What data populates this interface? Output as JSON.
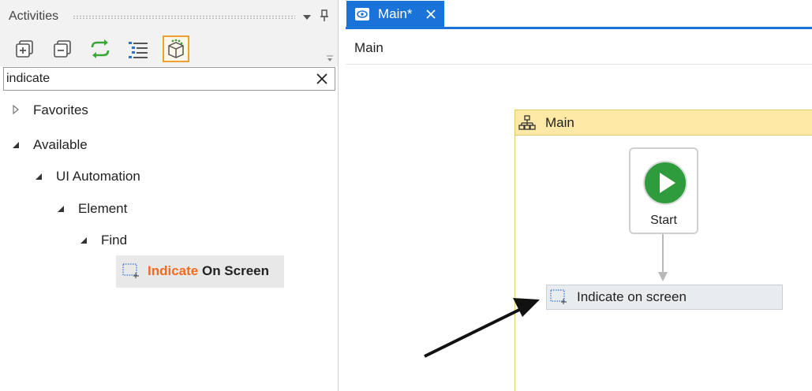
{
  "activities_panel": {
    "title": "Activities",
    "toolbar": {
      "buttons": [
        {
          "name": "expand-all",
          "icon": "expand-all-icon"
        },
        {
          "name": "collapse-all",
          "icon": "collapse-all-icon"
        },
        {
          "name": "refresh",
          "icon": "refresh-icon"
        },
        {
          "name": "view-options",
          "icon": "list-icon"
        },
        {
          "name": "show-packages",
          "icon": "package-icon",
          "active": true
        }
      ]
    },
    "search": {
      "value": "indicate",
      "placeholder": ""
    },
    "tree": {
      "favorites": "Favorites",
      "available": "Available",
      "ui_automation": "UI Automation",
      "element": "Element",
      "find": "Find",
      "result": {
        "match": "Indicate",
        "rest": " On Screen"
      }
    }
  },
  "designer": {
    "tab": {
      "label": "Main*"
    },
    "breadcrumb": "Main",
    "flowchart": {
      "title": "Main",
      "start_label": "Start",
      "activity_label": "Indicate on screen"
    }
  },
  "colors": {
    "accent": "#1a73d9",
    "highlight": "#f26b21",
    "flowchart_header": "#fde8a6",
    "start_green": "#2e9b3c"
  }
}
